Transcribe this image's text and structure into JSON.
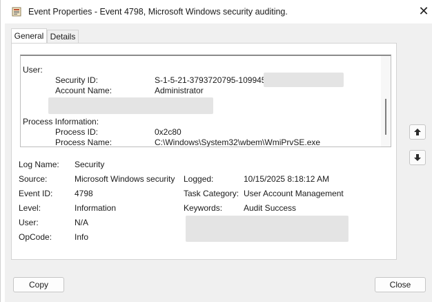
{
  "window": {
    "title": "Event Properties - Event 4798, Microsoft Windows security auditing.",
    "close_glyph": "✕"
  },
  "tabs": [
    {
      "label": "General",
      "active": true
    },
    {
      "label": "Details",
      "active": false
    }
  ],
  "description": {
    "user_header": "User:",
    "security_id_label": "Security ID:",
    "security_id_value": "S-1-5-21-3793720795-1099453",
    "account_name_label": "Account Name:",
    "account_name_value": "Administrator",
    "process_header": "Process Information:",
    "process_id_label": "Process ID:",
    "process_id_value": "0x2c80",
    "process_name_label": "Process Name:",
    "process_name_value": "C:\\Windows\\System32\\wbem\\WmiPrvSE.exe"
  },
  "fields": {
    "log_name_label": "Log Name:",
    "log_name_value": "Security",
    "source_label": "Source:",
    "source_value": "Microsoft Windows security",
    "logged_label": "Logged:",
    "logged_value": "10/15/2025 8:18:12 AM",
    "event_id_label": "Event ID:",
    "event_id_value": "4798",
    "task_category_label": "Task Category:",
    "task_category_value": "User Account Management",
    "level_label": "Level:",
    "level_value": "Information",
    "keywords_label": "Keywords:",
    "keywords_value": "Audit Success",
    "user_label": "User:",
    "user_value": "N/A",
    "opcode_label": "OpCode:",
    "opcode_value": "Info"
  },
  "buttons": {
    "copy": "Copy",
    "close": "Close"
  },
  "icons": {
    "title": "event-viewer-icon",
    "up": "arrow-up-icon",
    "down": "arrow-down-icon"
  }
}
